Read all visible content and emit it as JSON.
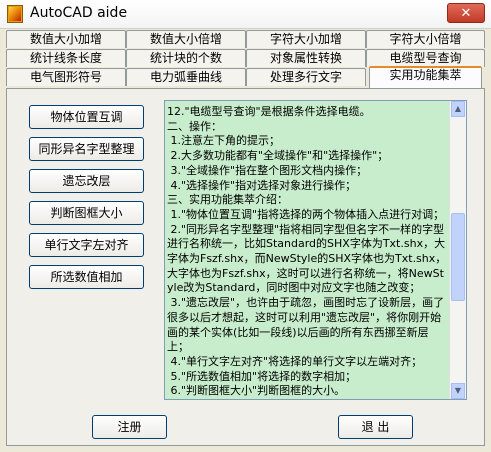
{
  "window": {
    "title": "AutoCAD aide",
    "close_glyph": "✕"
  },
  "tabs": [
    [
      "数值大小加增",
      "数值大小倍增",
      "字符大小加增",
      "字符大小倍增"
    ],
    [
      "统计线条长度",
      "统计块的个数",
      "对象属性转换",
      "电缆型号查询"
    ],
    [
      "电气图形符号",
      "电力弧垂曲线",
      "处理多行文字",
      "实用功能集萃"
    ]
  ],
  "active_tab": "实用功能集萃",
  "left_buttons": [
    "物体位置互调",
    "同形异名字型整理",
    "遗忘改层",
    "判断图框大小",
    "单行文字左对齐",
    "所选数值相加"
  ],
  "text_area": {
    "content": "12.\"电缆型号查询\"是根据条件选择电缆。\n二、操作：\n 1.注意左下角的提示；\n 2.大多数功能都有\"全域操作\"和\"选择操作\"；\n 3.\"全域操作\"指在整个图形文档内操作；\n 4.\"选择操作\"指对选择对象进行操作；\n三、实用功能集萃介绍：\n 1.\"物体位置互调\"指将选择的两个物体插入点进行对调；\n 2.\"同形异名字型整理\"指将相同字型但名字不一样的字型进行名称统一，比如Standard的SHX字体为Txt.shx，大字体为Fszf.shx，而NewStyle的SHX字体也为Txt.shx，大字体也为Fszf.shx，这时可以进行名称统一，将NewStyle改为Standard，同时图中对应文字也随之改变；\n 3.\"遗忘改层\"，也许由于疏忽，画图时忘了设新层，画了很多以后才想起，这时可以利用\"遗忘改层\"，将你刚开始画的某个实体(比如一段线)以后画的所有东西挪至新层上；\n 4.\"单行文字左对齐\"将选择的单行文字以左端对齐；\n 5.\"所选数值相加\"将选择的数字相加；\n 6.\"判断图框大小\"判断图框的大小。"
  },
  "bottom_buttons": {
    "register": "注册",
    "exit": "退  出"
  },
  "scrollbar": {
    "up_glyph": "▲",
    "down_glyph": "▼"
  }
}
